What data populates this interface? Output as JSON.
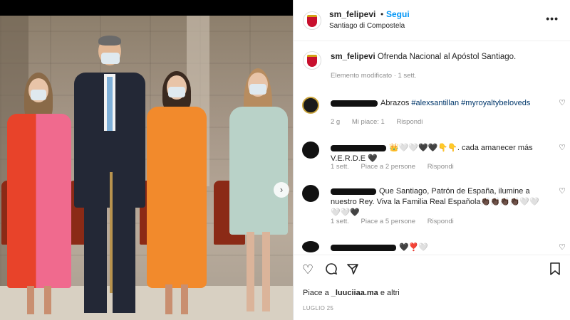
{
  "post": {
    "username": "sm_felipevi",
    "follow_label": "Segui",
    "separator": "•",
    "location": "Santiago di Compostela",
    "more_label": "•••",
    "caption_text": "Ofrenda Nacional al Apóstol Santiago.",
    "caption_meta": "Elemento modificato · 1 sett.",
    "likes_prefix": "Piace a ",
    "likes_user": "_luuciiaa.ma",
    "likes_suffix": " e altri",
    "date": "LUGLIO 25"
  },
  "comments": [
    {
      "text_before": "Abrazos ",
      "tags": "#alexsantillan #myroyaltybeloveds",
      "meta": [
        "2 g",
        "Mi piace: 1",
        "Rispondi"
      ]
    },
    {
      "text_before": "",
      "tags": "",
      "text_after": "👑🤍🤍🖤🖤👇👇. cada amanecer más V.E.R.D.E 🖤",
      "meta": [
        "1 sett.",
        "Piace a 2 persone",
        "Rispondi"
      ]
    },
    {
      "text_before": "Que Santiago, Patrón de España, ilumine a nuestro Rey. Viva la Familia Real Española👏🏿👏🏿👏🏿👏🏿🤍🤍🤍🤍🖤",
      "tags": "",
      "meta": [
        "1 sett.",
        "Piace a 5 persone",
        "Rispondi"
      ]
    },
    {
      "text_before": "🖤❣️🤍",
      "tags": "",
      "meta": []
    }
  ],
  "icons": {
    "heart": "heart-icon",
    "comment": "comment-icon",
    "share": "share-icon",
    "bookmark": "bookmark-icon",
    "next": "chevron-right-icon"
  },
  "colors": {
    "link": "#0095f6",
    "hashtag": "#00376b",
    "meta": "#8e8e8e"
  }
}
